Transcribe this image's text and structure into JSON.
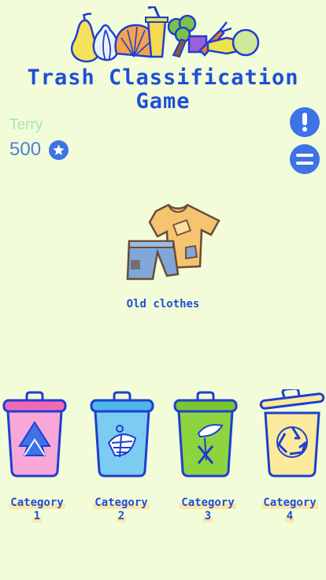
{
  "title": {
    "line1": "Trash Classification",
    "line2": "Game"
  },
  "user": {
    "name": "Terry",
    "score": "500"
  },
  "icons": {
    "banner": "food-waste-banner-icon",
    "star": "star-icon",
    "info": "exclamation-icon",
    "menu": "menu-icon",
    "item": "old-clothes-icon"
  },
  "current_item": {
    "label": "Old clothes"
  },
  "bins": [
    {
      "label_line1": "Category",
      "label_line2": "1",
      "color": "#F7A8D8",
      "lid": "#F06BB4"
    },
    {
      "label_line1": "Category",
      "label_line2": "2",
      "color": "#7CCCF2",
      "lid": "#4DB6EA"
    },
    {
      "label_line1": "Category",
      "label_line2": "3",
      "color": "#8ED43E",
      "lid": "#7BC62F"
    },
    {
      "label_line1": "Category",
      "label_line2": "4",
      "color": "#FBEA9C",
      "lid": "#FBEA9C"
    }
  ],
  "colors": {
    "background": "#F2FCD8",
    "accent": "#1E4FD8",
    "button": "#3E73E6",
    "outline": "#1E3FD0"
  }
}
